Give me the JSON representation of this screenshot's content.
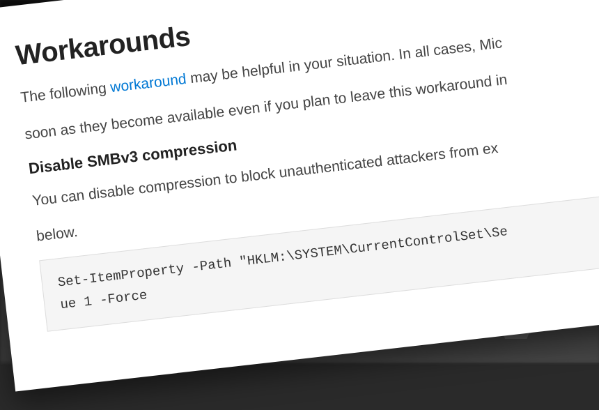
{
  "document": {
    "heading": "Workarounds",
    "para1_prefix": "The following ",
    "para1_link": "workaround",
    "para1_line1_suffix": " may be helpful in your situation. In all cases, Mic",
    "para1_line2": "soon as they become available even if you plan to leave this workaround in",
    "subheading": "Disable SMBv3 compression",
    "para2_line1": "You can disable compression to block unauthenticated attackers from ex",
    "para2_line2": "below.",
    "code_line1": "Set-ItemProperty -Path \"HKLM:\\SYSTEM\\CurrentControlSet\\Se",
    "code_line2": "ue 1 -Force"
  }
}
